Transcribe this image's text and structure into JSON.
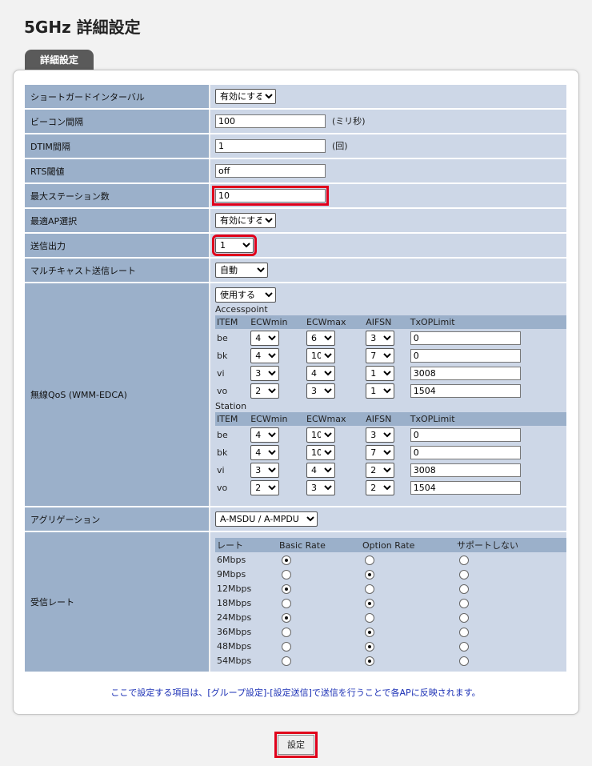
{
  "title": "5GHz 詳細設定",
  "tab": "詳細設定",
  "rows": {
    "short_gi": {
      "label": "ショートガードインターバル",
      "value": "有効にする"
    },
    "beacon": {
      "label": "ビーコン間隔",
      "value": "100",
      "unit": "(ミリ秒)"
    },
    "dtim": {
      "label": "DTIM間隔",
      "value": "1",
      "unit": "(回)"
    },
    "rts": {
      "label": "RTS閾値",
      "value": "off"
    },
    "max_sta": {
      "label": "最大ステーション数",
      "value": "10"
    },
    "best_ap": {
      "label": "最適AP選択",
      "value": "有効にする"
    },
    "tx_power": {
      "label": "送信出力",
      "value": "1"
    },
    "mcast_rate": {
      "label": "マルチキャスト送信レート",
      "value": "自動"
    },
    "qos": {
      "label": "無線QoS (WMM-EDCA)",
      "value": "使用する"
    },
    "aggregation": {
      "label": "アグリゲーション",
      "value": "A-MSDU / A-MPDU"
    },
    "rx_rate": {
      "label": "受信レート"
    }
  },
  "qos": {
    "headers": [
      "ITEM",
      "ECWmin",
      "ECWmax",
      "AIFSN",
      "TxOPLimit"
    ],
    "accesspoint": {
      "title": "Accesspoint",
      "rows": [
        {
          "item": "be",
          "ecwmin": "4",
          "ecwmax": "6",
          "aifsn": "3",
          "txop": "0"
        },
        {
          "item": "bk",
          "ecwmin": "4",
          "ecwmax": "10",
          "aifsn": "7",
          "txop": "0"
        },
        {
          "item": "vi",
          "ecwmin": "3",
          "ecwmax": "4",
          "aifsn": "1",
          "txop": "3008"
        },
        {
          "item": "vo",
          "ecwmin": "2",
          "ecwmax": "3",
          "aifsn": "1",
          "txop": "1504"
        }
      ]
    },
    "station": {
      "title": "Station",
      "rows": [
        {
          "item": "be",
          "ecwmin": "4",
          "ecwmax": "10",
          "aifsn": "3",
          "txop": "0"
        },
        {
          "item": "bk",
          "ecwmin": "4",
          "ecwmax": "10",
          "aifsn": "7",
          "txop": "0"
        },
        {
          "item": "vi",
          "ecwmin": "3",
          "ecwmax": "4",
          "aifsn": "2",
          "txop": "3008"
        },
        {
          "item": "vo",
          "ecwmin": "2",
          "ecwmax": "3",
          "aifsn": "2",
          "txop": "1504"
        }
      ]
    }
  },
  "rates": {
    "headers": [
      "レート",
      "Basic Rate",
      "Option Rate",
      "サポートしない"
    ],
    "rows": [
      {
        "rate": "6Mbps",
        "selected": "basic"
      },
      {
        "rate": "9Mbps",
        "selected": "option"
      },
      {
        "rate": "12Mbps",
        "selected": "basic"
      },
      {
        "rate": "18Mbps",
        "selected": "option"
      },
      {
        "rate": "24Mbps",
        "selected": "basic"
      },
      {
        "rate": "36Mbps",
        "selected": "option"
      },
      {
        "rate": "48Mbps",
        "selected": "option"
      },
      {
        "rate": "54Mbps",
        "selected": "option"
      }
    ]
  },
  "note": "ここで設定する項目は、[グループ設定]-[設定送信]で送信を行うことで各APに反映されます。",
  "submit_label": "設定",
  "colors": {
    "label_bg": "#9bb0ca",
    "value_bg": "#cdd7e7",
    "highlight": "#e0001b",
    "note_text": "#1a2fb5"
  }
}
